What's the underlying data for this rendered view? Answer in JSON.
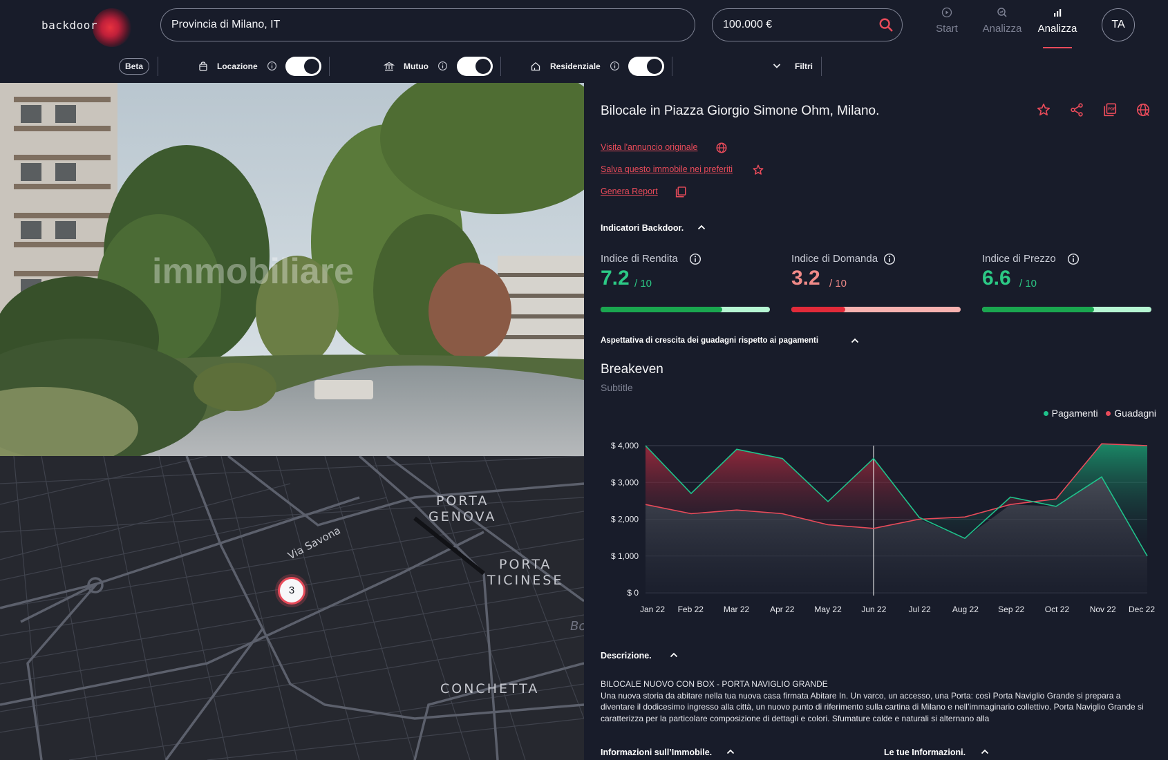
{
  "app": {
    "logo_text": "backdoor"
  },
  "search": {
    "location": "Provincia di Milano, IT",
    "price": "100.000 €"
  },
  "nav": {
    "items": [
      {
        "label": "Start",
        "icon": "play-circle-icon",
        "active": false
      },
      {
        "label": "Analizza",
        "icon": "search-chart-icon",
        "active": false
      },
      {
        "label": "Analizza",
        "icon": "bar-chart-icon",
        "active": true
      }
    ]
  },
  "user": {
    "initials": "TA"
  },
  "filters": {
    "beta": "Beta",
    "locazione": {
      "label": "Locazione",
      "on": true
    },
    "mutuo": {
      "label": "Mutuo",
      "on": true
    },
    "residenziale": {
      "label": "Residenziale",
      "on": true
    },
    "filtri": "Filtri"
  },
  "listing": {
    "title": "Bilocale in Piazza Giorgio Simone Ohm, Milano.",
    "photo_watermark": "immobiliare",
    "links": {
      "original": "Visita l'annuncio originale",
      "save": "Salva questo immobile nei preferiti",
      "report": "Genera Report"
    }
  },
  "indicators": {
    "header": "Indicatori Backdoor.",
    "items": [
      {
        "label": "Indice di Rendita",
        "value": "7.2",
        "denominator": "/ 10",
        "score": 7.2,
        "color": "#2cc985",
        "track": "#b6f5d3",
        "fill": "#1aa64f"
      },
      {
        "label": "Indice di Domanda",
        "value": "3.2",
        "denominator": "/ 10",
        "score": 3.2,
        "color": "#f08a88",
        "track": "#f7b2b0",
        "fill": "#e22a39"
      },
      {
        "label": "Indice di Prezzo",
        "value": "6.6",
        "denominator": "/ 10",
        "score": 6.6,
        "color": "#2cc985",
        "track": "#b6f5d3",
        "fill": "#1aa64f"
      }
    ]
  },
  "growth": {
    "header": "Aspettativa di crescita dei guadagni rispetto ai pagamenti"
  },
  "chart_data": {
    "type": "area",
    "title": "Breakeven",
    "subtitle": "Subtitle",
    "categories": [
      "Jan 22",
      "Feb 22",
      "Mar 22",
      "Apr 22",
      "May 22",
      "Jun 22",
      "Jul 22",
      "Aug 22",
      "Sep 22",
      "Oct 22",
      "Nov 22",
      "Dec 22"
    ],
    "series": [
      {
        "name": "Pagamenti",
        "color": "#1fc28b",
        "values": [
          4000,
          2700,
          3900,
          3650,
          2480,
          3650,
          2050,
          1480,
          2600,
          2350,
          3150,
          1000
        ]
      },
      {
        "name": "Guadagni",
        "color": "#e94b5a",
        "values": [
          2400,
          2150,
          2250,
          2150,
          1850,
          1750,
          2000,
          2060,
          2400,
          2550,
          4050,
          4000
        ]
      }
    ],
    "yticks": [
      "$ 4,000",
      "$ 3,000",
      "$ 2,000",
      "$ 1,000",
      "$ 0"
    ],
    "ylim": [
      0,
      4000
    ],
    "legend": "top-right",
    "crosshair_category": "Jun 22"
  },
  "description": {
    "header": "Descrizione.",
    "title": "BILOCALE NUOVO CON BOX - PORTA NAVIGLIO GRANDE",
    "text": "Una nuova storia da abitare nella tua nuova casa firmata Abitare In. Un varco, un accesso, una Porta: così Porta Naviglio Grande si prepara a diventare il dodicesimo ingresso alla città, un nuovo punto di riferimento sulla cartina di Milano e nell’immaginario collettivo. Porta Naviglio Grande si caratterizza per la particolare composizione di dettagli e colori. Sfumature calde e naturali si alternano alla"
  },
  "sections": {
    "info_immobile": "Informazioni sull’Immobile.",
    "tue_info": "Le tue Informazioni."
  },
  "map": {
    "labels": {
      "porta_genova": "PORTA\nGENOVA",
      "porta_ticinese": "PORTA\nTICINESE",
      "conchetta": "CONCHETTA",
      "via_savona": "Via Savona",
      "edge": "Bo"
    },
    "marker_count": "3"
  }
}
